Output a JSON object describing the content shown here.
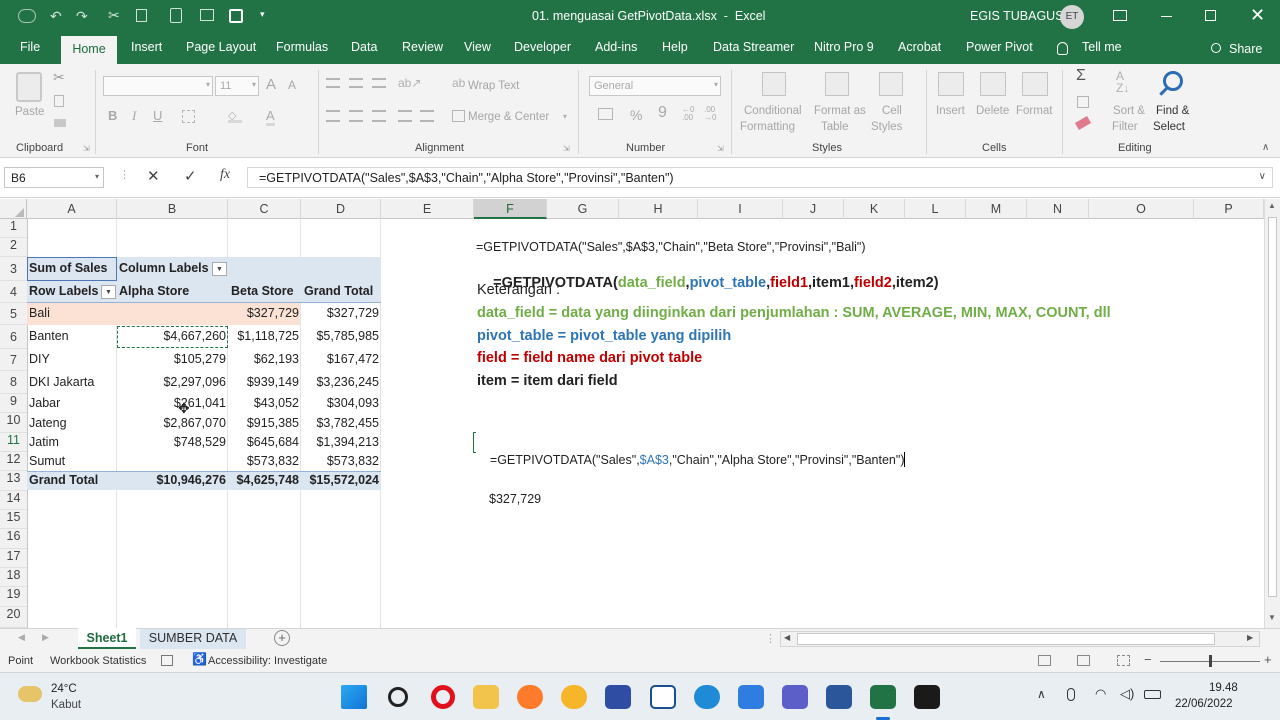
{
  "window": {
    "doc_title": "01. menguasai GetPivotData.xlsx  -  Excel",
    "user_name": "EGIS TUBAGUS",
    "user_initials": "ET"
  },
  "ribbon_tabs": [
    "File",
    "Home",
    "Insert",
    "Page Layout",
    "Formulas",
    "Data",
    "Review",
    "View",
    "Developer",
    "Add-ins",
    "Help",
    "Data Streamer",
    "Nitro Pro 9",
    "Acrobat",
    "Power Pivot",
    "Tell me",
    "Share"
  ],
  "ribbon": {
    "clipboard": {
      "paste": "Paste",
      "label": "Clipboard"
    },
    "font": {
      "name": "",
      "size": "11",
      "label": "Font"
    },
    "alignment": {
      "wrap": "Wrap Text",
      "merge": "Merge & Center",
      "label": "Alignment"
    },
    "number": {
      "format": "General",
      "label": "Number"
    },
    "styles": {
      "cond1": "Conditional",
      "cond2": "Formatting",
      "fmt1": "Format as",
      "fmt2": "Table",
      "cell1": "Cell",
      "cell2": "Styles",
      "label": "Styles"
    },
    "cells": {
      "insert": "Insert",
      "delete": "Delete",
      "format": "Format",
      "label": "Cells"
    },
    "editing": {
      "sort1": "Sort &",
      "sort2": "Filter",
      "find1": "Find &",
      "find2": "Select",
      "label": "Editing"
    }
  },
  "formula_bar": {
    "name_box": "B6",
    "formula": "=GETPIVOTDATA(\"Sales\",$A$3,\"Chain\",\"Alpha Store\",\"Provinsi\",\"Banten\")"
  },
  "columns": [
    "A",
    "B",
    "C",
    "D",
    "E",
    "F",
    "G",
    "H",
    "I",
    "J",
    "K",
    "L",
    "M",
    "N",
    "O",
    "P"
  ],
  "rows": [
    "1",
    "2",
    "3",
    "4",
    "5",
    "6",
    "7",
    "8",
    "9",
    "10",
    "11",
    "12",
    "13",
    "14",
    "15",
    "16",
    "17",
    "18",
    "19",
    "20"
  ],
  "pivot": {
    "corner": "Sum of Sales",
    "col_labels": "Column Labels",
    "row_labels": "Row Labels",
    "headers": [
      "Alpha Store",
      "Beta Store",
      "Grand Total"
    ],
    "body": [
      [
        "Bali",
        "",
        "$327,729",
        "$327,729"
      ],
      [
        "Banten",
        "$4,667,260",
        "$1,118,725",
        "$5,785,985"
      ],
      [
        "DIY",
        "$105,279",
        "$62,193",
        "$167,472"
      ],
      [
        "DKI Jakarta",
        "$2,297,096",
        "$939,149",
        "$3,236,245"
      ],
      [
        "Jabar",
        "$261,041",
        "$43,052",
        "$304,093"
      ],
      [
        "Jateng",
        "$2,867,070",
        "$915,385",
        "$3,782,455"
      ],
      [
        "Jatim",
        "$748,529",
        "$645,684",
        "$1,394,213"
      ],
      [
        "Sumut",
        "",
        "$573,832",
        "$573,832"
      ]
    ],
    "total": [
      "Grand Total",
      "$10,946,276",
      "$4,625,748",
      "$15,572,024"
    ]
  },
  "notes": {
    "example": "=GETPIVOTDATA(\"Sales\",$A$3,\"Chain\",\"Beta Store\",\"Provinsi\",\"Bali\")",
    "syntax": {
      "p1": "=GETPIVOTDATA(",
      "p2": "data_field",
      "p3": ",",
      "p4": "pivot_table",
      "p5": ",",
      "p6": "field1",
      "p7": ",item1,",
      "p8": "field2",
      "p9": ",item2)"
    },
    "keterangan": "Keterangan :",
    "line1": "data_field = data yang diinginkan dari penjumlahan : SUM, AVERAGE, MIN, MAX, COUNT, dll",
    "line2": "pivot_table = pivot_table yang dipilih",
    "line3": "field = field name dari pivot table",
    "line4": "item = item dari field",
    "edit": {
      "a": "=GETPIVOTDATA(\"Sales\",",
      "b": "$A$3",
      "c": ",\"Chain\",\"Alpha Store\",\"Provinsi\",\"Banten\")"
    },
    "result": "$327,729"
  },
  "sheets": [
    "Sheet1",
    "SUMBER DATA"
  ],
  "status": {
    "mode": "Point",
    "stats": "Workbook Statistics",
    "access": "Accessibility: Investigate"
  },
  "taskbar": {
    "temp": "24°C",
    "weather": "Kabut",
    "time": "19.48",
    "date": "22/06/2022"
  },
  "colors": {
    "excel_green": "#217346",
    "pivot_header": "#dce6f1",
    "pivot_highlight": "#fbe2d5",
    "syntax_green": "#70ad47",
    "syntax_blue": "#2e75b6",
    "syntax_red": "#c00000"
  }
}
